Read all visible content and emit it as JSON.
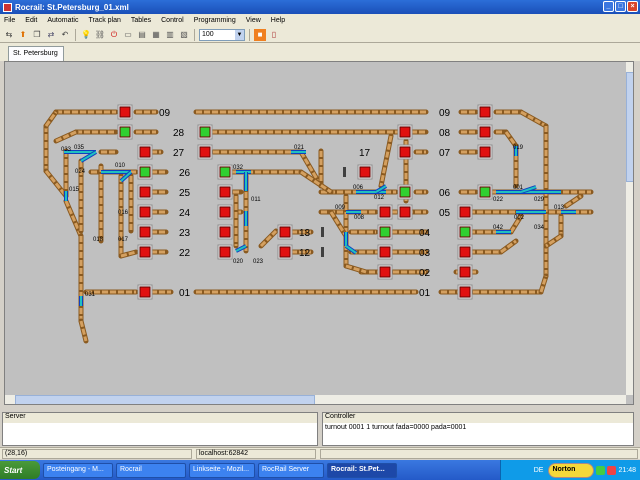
{
  "window": {
    "title": "Rocrail: St.Petersburg_01.xml",
    "controls": [
      "_",
      "□",
      "×"
    ]
  },
  "menu": [
    "File",
    "Edit",
    "Automatic",
    "Track plan",
    "Tables",
    "Control",
    "Programming",
    "View",
    "Help"
  ],
  "toolbar": {
    "zoom_value": "100",
    "icons": [
      "network-icon",
      "up-arrow-icon",
      "copy-icon",
      "swap-icon",
      "undo-icon",
      "lightbulb-icon",
      "chain-icon",
      "power-icon",
      "page-icon",
      "loco-icon",
      "train-icon",
      "route-icon",
      "plus-icon",
      "minus-icon",
      "stop-icon",
      "book-icon"
    ]
  },
  "tab": {
    "label": "St. Petersburg"
  },
  "layout": {
    "block_labels_left": [
      "09",
      "28",
      "27",
      "26",
      "25",
      "24",
      "23",
      "22",
      "13",
      "12",
      "01"
    ],
    "block_labels_right": [
      "09",
      "08",
      "07",
      "06",
      "05",
      "04",
      "03",
      "02",
      "01",
      "17"
    ],
    "switch_ids": [
      "035",
      "010",
      "032",
      "021",
      "023",
      "020",
      "006",
      "012",
      "022",
      "001",
      "029",
      "013",
      "009",
      "008",
      "002",
      "042",
      "034",
      "016",
      "017",
      "018",
      "019",
      "024",
      "015",
      "011",
      "031",
      "033"
    ]
  },
  "panes": {
    "server": {
      "title": "Server",
      "text": ""
    },
    "controller": {
      "title": "Controller",
      "text": "turnout 0001 1 turnout    fada=0000 pada=0001"
    }
  },
  "status": {
    "coords": "(28,16)",
    "host": "localhost:62842"
  },
  "taskbar": {
    "start": "Start",
    "tasks": [
      "Posteingang - M...",
      "Rocrail",
      "Linkseite - Mozil...",
      "RocRail Server",
      "Rocrail: St.Pet..."
    ],
    "lang": "DE",
    "norton": "Norton",
    "clock": "21:48"
  },
  "colors": {
    "signal_red": "#e01010",
    "signal_green": "#30d030",
    "track": "#d4a060",
    "switch_blue": "#1040c0",
    "switch_cyan": "#20c0c0"
  }
}
